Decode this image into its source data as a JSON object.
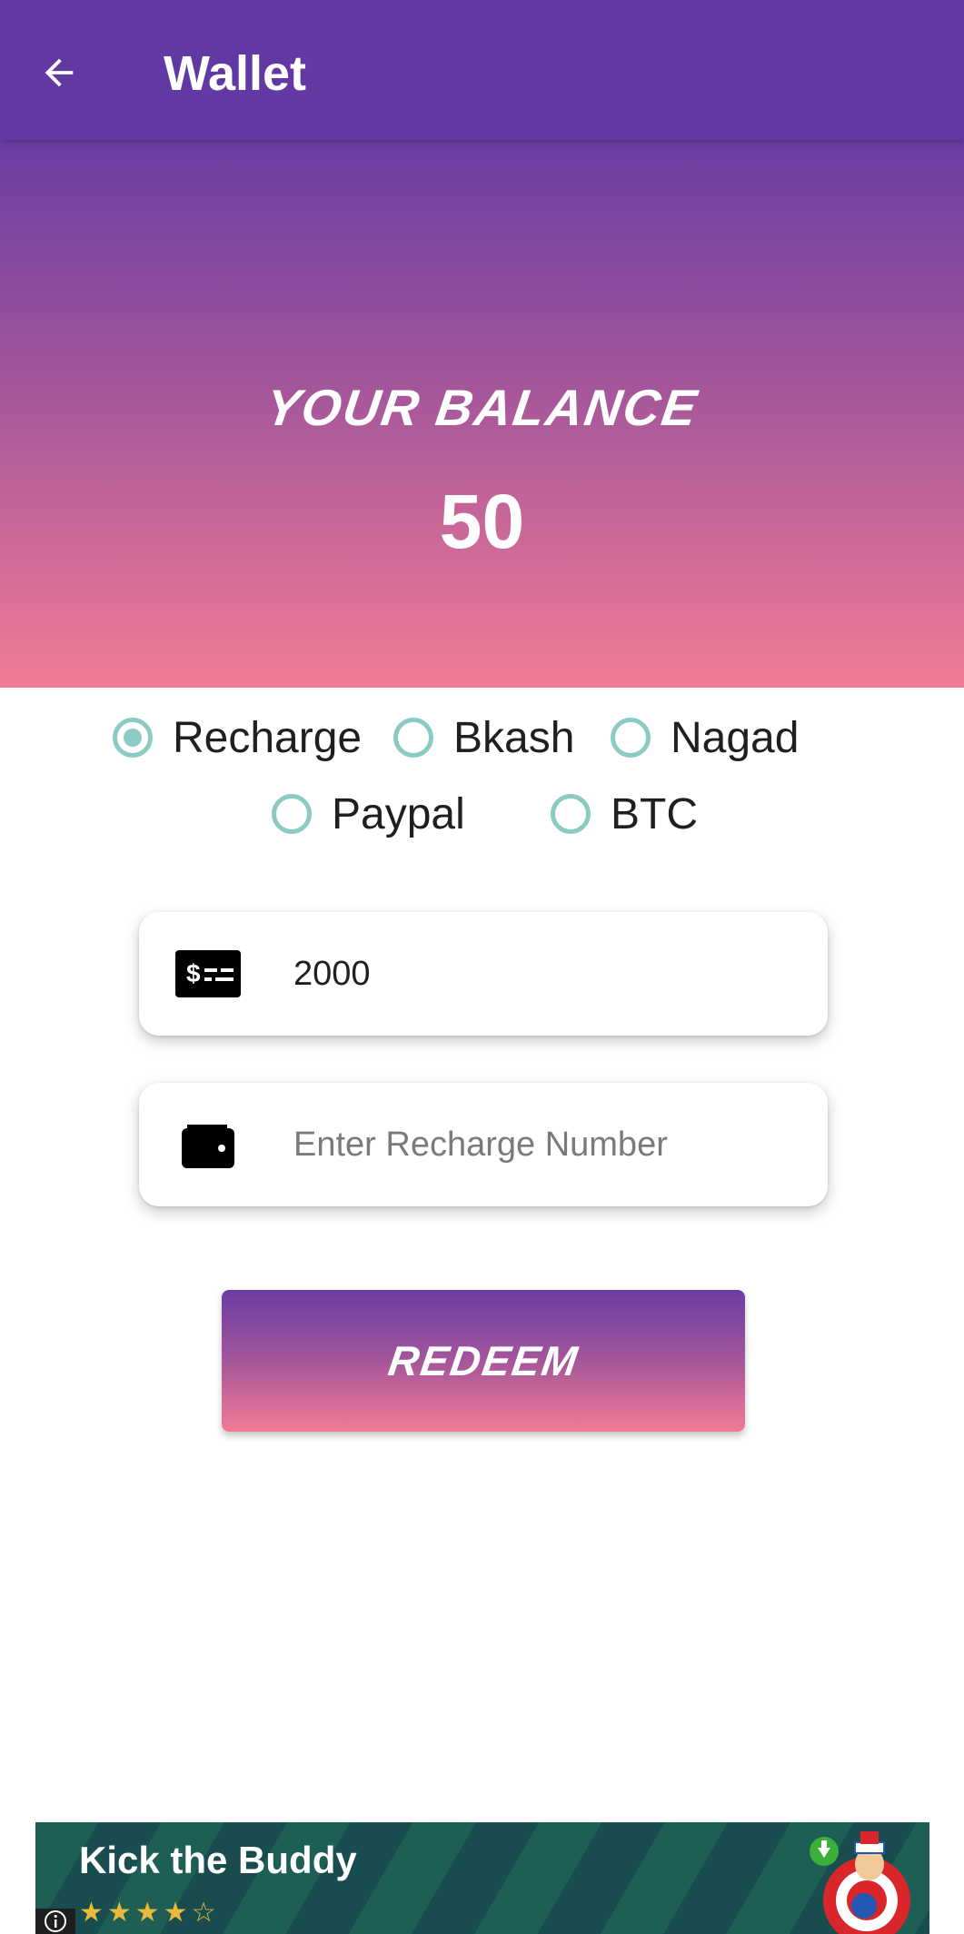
{
  "appbar": {
    "title": "Wallet",
    "back_icon": "arrow-left-icon",
    "color": "#6239a2"
  },
  "balance": {
    "label": "YOUR BALANCE",
    "value": "50",
    "gradient": [
      "#6a3da4",
      "#a4569a",
      "#f27b96"
    ]
  },
  "payment_methods": [
    {
      "label": "Recharge",
      "selected": true
    },
    {
      "label": "Bkash",
      "selected": false
    },
    {
      "label": "Nagad",
      "selected": false
    },
    {
      "label": "Paypal",
      "selected": false
    },
    {
      "label": "BTC",
      "selected": false
    }
  ],
  "amount_field": {
    "value": "2000",
    "icon": "money-bill-icon"
  },
  "number_field": {
    "value": "",
    "placeholder": "Enter Recharge Number",
    "icon": "wallet-icon"
  },
  "redeem_button": {
    "label": "REDEEM"
  },
  "ad": {
    "title": "Kick the Buddy",
    "stars": "★★★★☆",
    "rating": 4.5
  },
  "colors": {
    "accent": "#8ccac4",
    "primary": "#6239a2",
    "pink": "#f27b96"
  }
}
